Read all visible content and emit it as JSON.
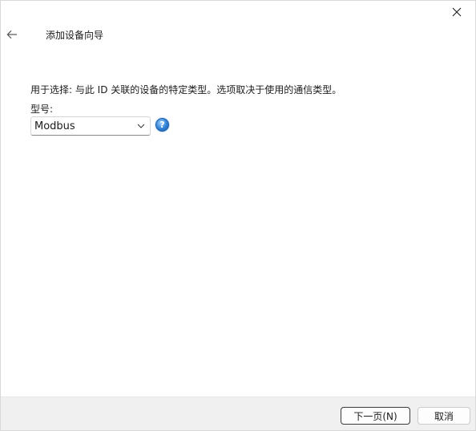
{
  "window": {
    "title": "添加设备向导"
  },
  "main": {
    "description": "用于选择: 与此 ID 关联的设备的特定类型。选项取决于使用的通信类型。",
    "model_label": "型号:",
    "model_select": {
      "selected": "Modbus"
    },
    "help_icon_glyph": "?"
  },
  "footer": {
    "next_label": "下一页(N)",
    "cancel_label": "取消"
  },
  "icons": {
    "close": "close-icon",
    "back": "back-arrow-icon",
    "chevron": "chevron-down-icon",
    "help": "help-icon"
  },
  "colors": {
    "help_icon_blue": "#2f7fd4",
    "footer_bg": "#f0f0f0"
  }
}
